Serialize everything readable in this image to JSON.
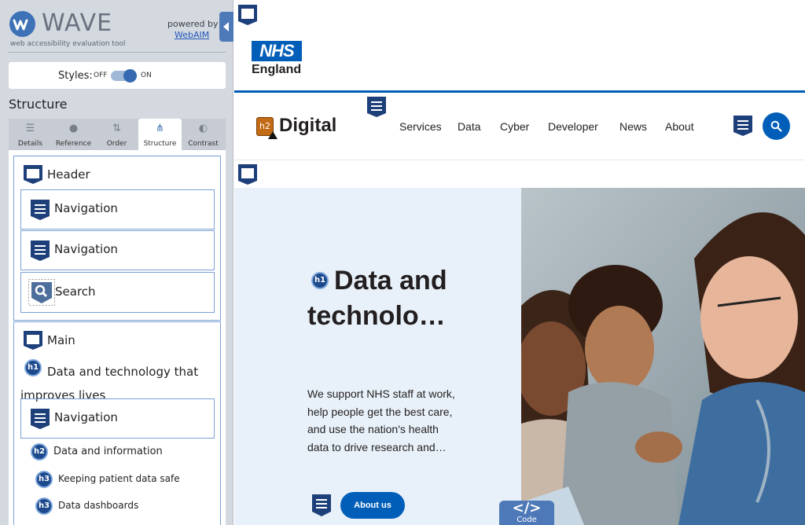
{
  "wave": {
    "name": "WAVE",
    "tagline": "web accessibility evaluation tool",
    "powered_by": "powered by",
    "webaim_link": "WebAIM",
    "styles_label": "Styles:",
    "styles_off": "OFF",
    "styles_on": "ON",
    "styles_state": "on",
    "section_title": "Structure",
    "tabs": [
      {
        "label": "Details",
        "icon": "list-icon"
      },
      {
        "label": "Reference",
        "icon": "info-icon"
      },
      {
        "label": "Order",
        "icon": "order-icon"
      },
      {
        "label": "Structure",
        "icon": "structure-icon",
        "active": true
      },
      {
        "label": "Contrast",
        "icon": "contrast-icon"
      }
    ],
    "structure": {
      "header": "Header",
      "nav1": "Navigation",
      "nav2": "Navigation",
      "search": "Search",
      "main": "Main",
      "h1_badge": "h1",
      "h1_text": "Data and technology that improves lives",
      "nav3": "Navigation",
      "h2_badge": "h2",
      "h2_text": "Data and information",
      "h3a_badge": "h3",
      "h3a_text": "Keeping patient data safe",
      "h3b_badge": "h3",
      "h3b_text": "Data dashboards"
    }
  },
  "site": {
    "nhs_logo": "NHS",
    "nhs_sub": "England",
    "brand": "Digital",
    "h2_warn_badge": "h2",
    "nav": [
      "Services",
      "Data",
      "Cyber",
      "Developer",
      "News",
      "About"
    ],
    "h1_badge": "h1",
    "hero_title": "Data and technolo…",
    "hero_text": "We support NHS staff at work, help people get the best care, and use the nation's health data to drive research and…",
    "about_button": "About us",
    "code_glyph": "</>",
    "code_label": "Code"
  },
  "colors": {
    "nhs_blue": "#005eb8",
    "wave_blue": "#3d72b7",
    "warning_orange": "#c26a16"
  }
}
